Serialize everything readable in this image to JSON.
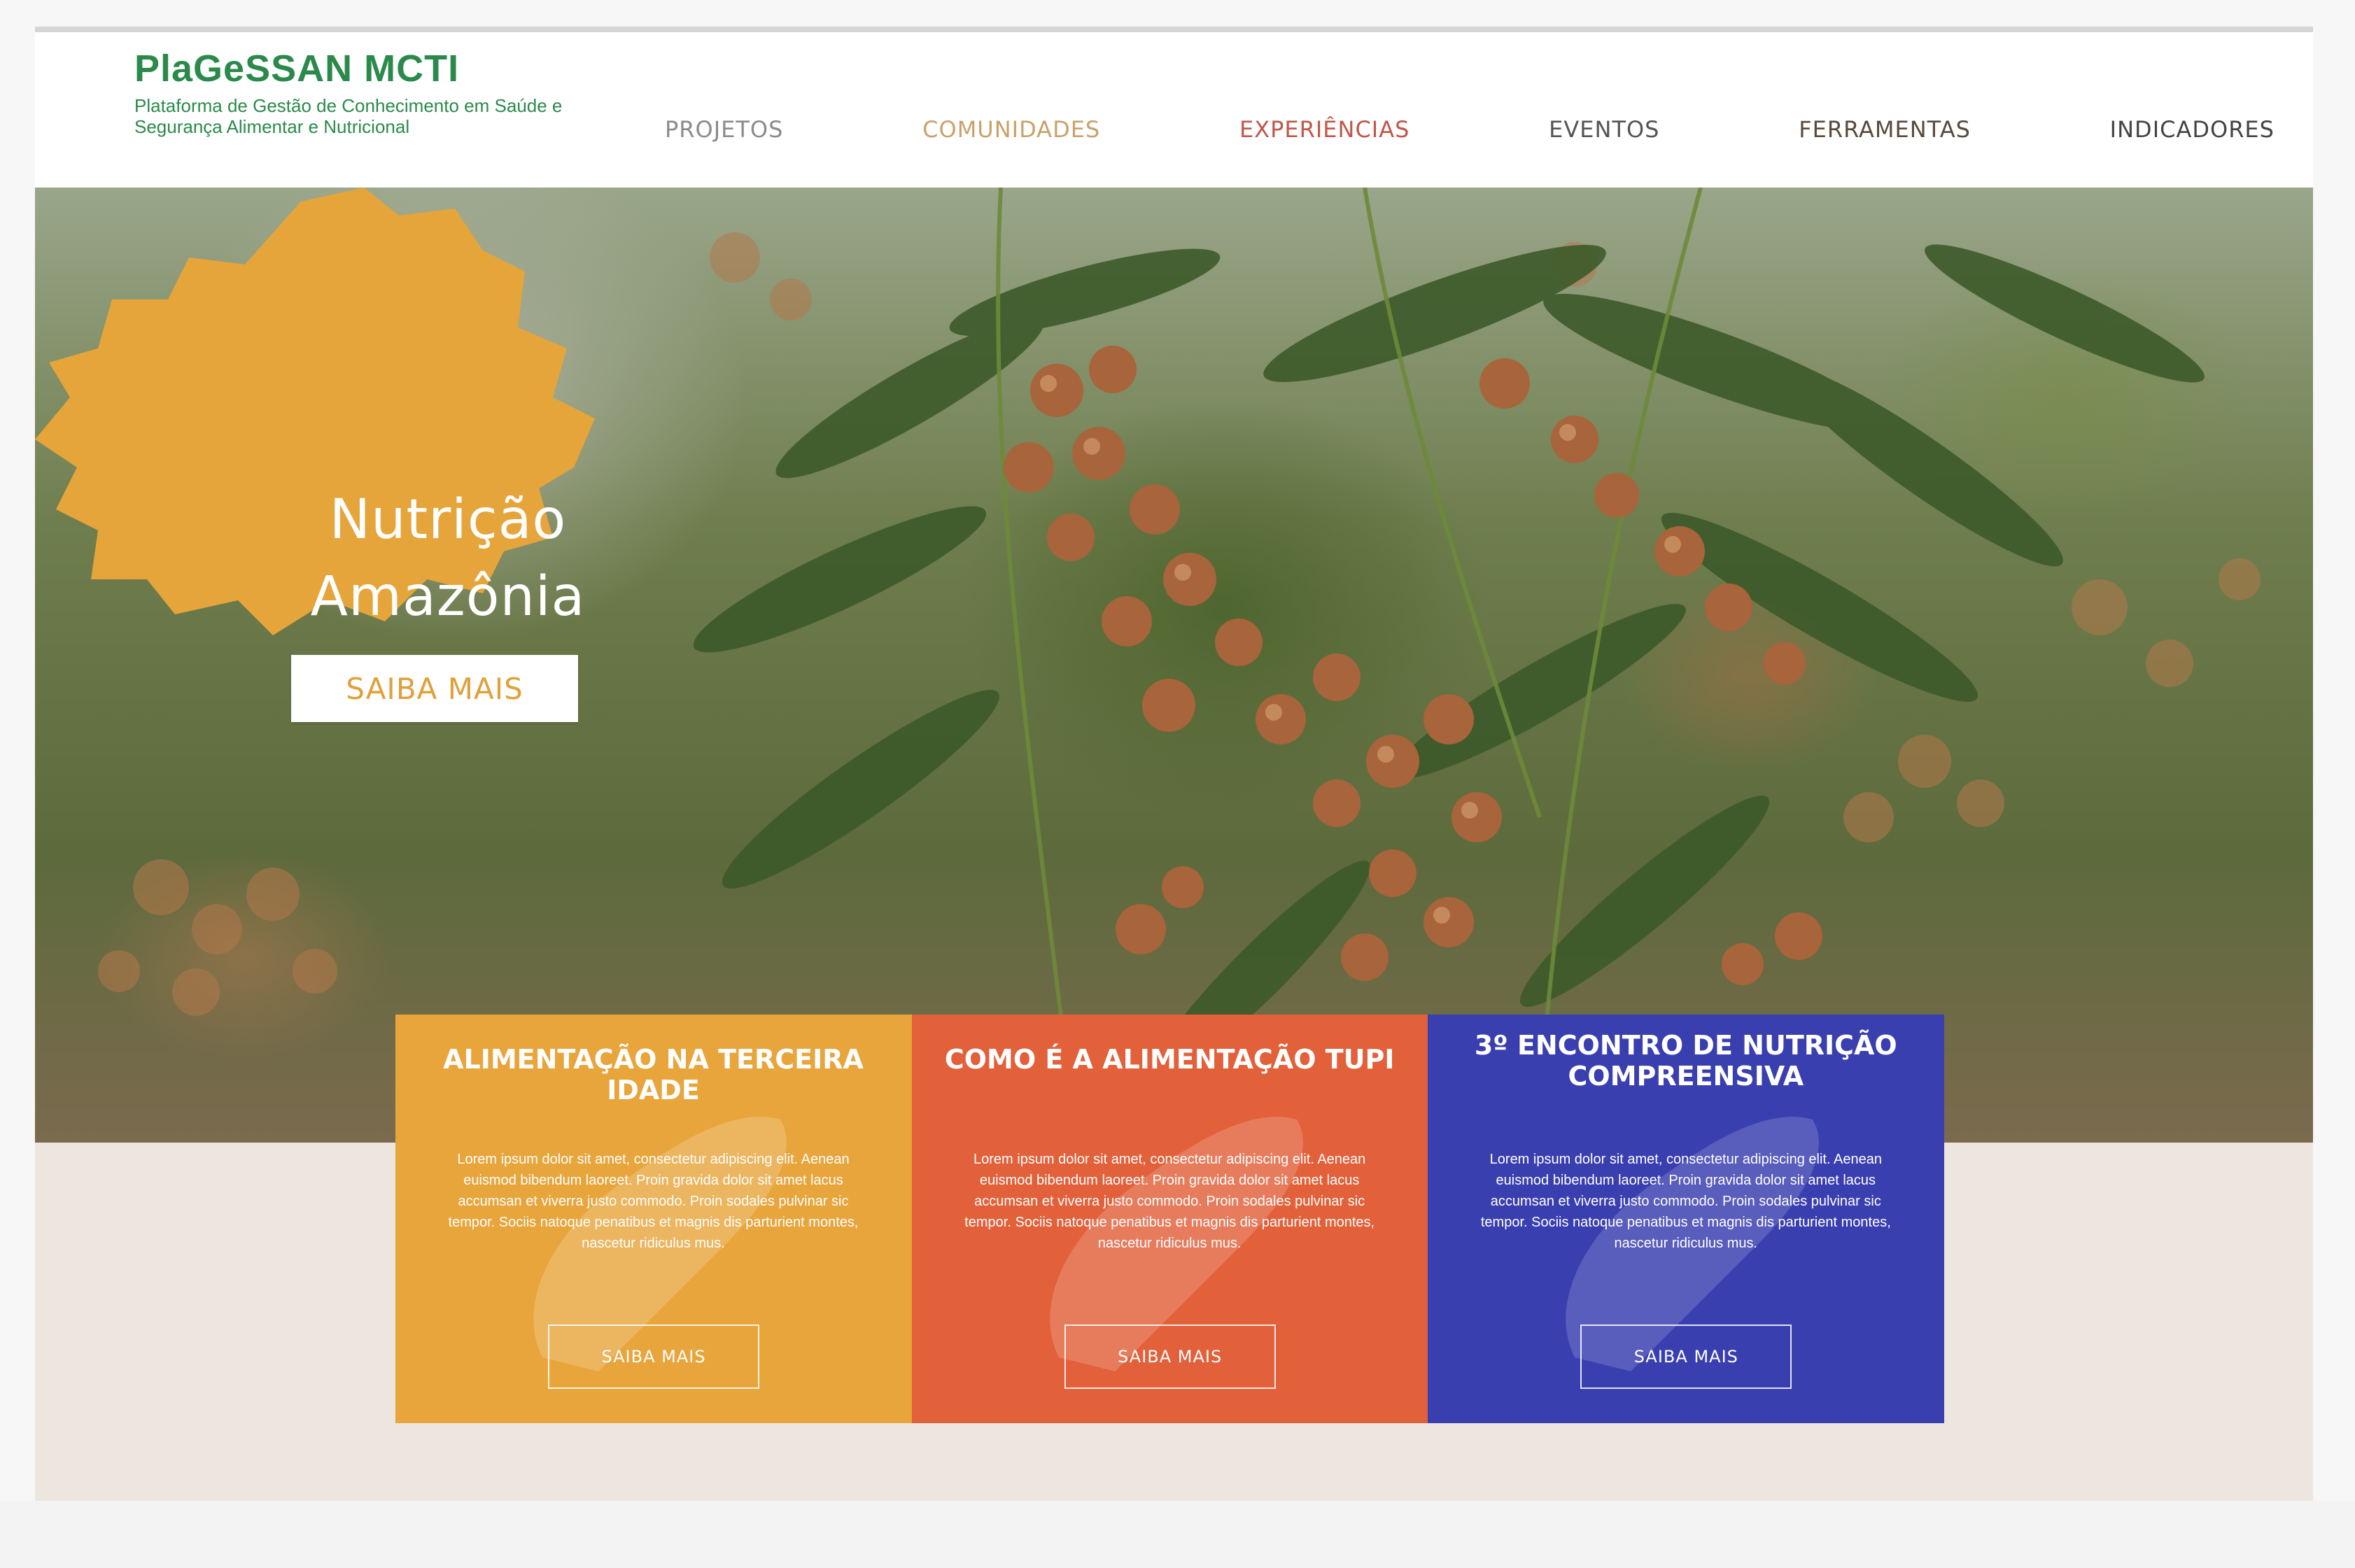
{
  "brand": {
    "title": "PlaGeSSAN MCTI",
    "subtitle": "Plataforma de Gestão de Conhecimento em Saúde e Segurança Alimentar e Nutricional",
    "color": "#2b8a4b"
  },
  "nav": {
    "items": [
      {
        "label": "PROJETOS",
        "color": "#8b8b8b"
      },
      {
        "label": "COMUNIDADES",
        "color": "#c9a26a"
      },
      {
        "label": "EXPERIÊNCIAS",
        "color": "#c0574a"
      },
      {
        "label": "EVENTOS",
        "color": "#555555"
      },
      {
        "label": "FERRAMENTAS",
        "color": "#5a4a3c"
      },
      {
        "label": "INDICADORES",
        "color": "#444444"
      }
    ]
  },
  "hero": {
    "title_line1": "Nutrição",
    "title_line2": "Amazônia",
    "button_label": "SAIBA MAIS",
    "accent": "#e6a53a"
  },
  "cards": [
    {
      "title": "ALIMENTAÇÃO NA TERCEIRA IDADE",
      "body": "Lorem ipsum dolor sit amet, consectetur adipiscing elit. Aenean euismod bibendum laoreet. Proin gravida dolor sit amet lacus accumsan et viverra justo commodo. Proin sodales pulvinar sic tempor. Sociis natoque penatibus et magnis dis parturient montes, nascetur ridiculus mus.",
      "button_label": "SAIBA MAIS",
      "color": "#e8a53c"
    },
    {
      "title": "COMO É A ALIMENTAÇÃO TUPI",
      "body": "Lorem ipsum dolor sit amet, consectetur adipiscing elit. Aenean euismod bibendum laoreet. Proin gravida dolor sit amet lacus accumsan et viverra justo commodo. Proin sodales pulvinar sic tempor. Sociis natoque penatibus et magnis dis parturient montes, nascetur ridiculus mus.",
      "button_label": "SAIBA MAIS",
      "color": "#e2603a"
    },
    {
      "title": "3º ENCONTRO DE NUTRIÇÃO COMPREENSIVA",
      "body": "Lorem ipsum dolor sit amet, consectetur adipiscing elit. Aenean euismod bibendum laoreet. Proin gravida dolor sit amet lacus accumsan et viverra justo commodo. Proin sodales pulvinar sic tempor. Sociis natoque penatibus et magnis dis parturient montes, nascetur ridiculus mus.",
      "button_label": "SAIBA MAIS",
      "color": "#3a3fb0"
    }
  ]
}
